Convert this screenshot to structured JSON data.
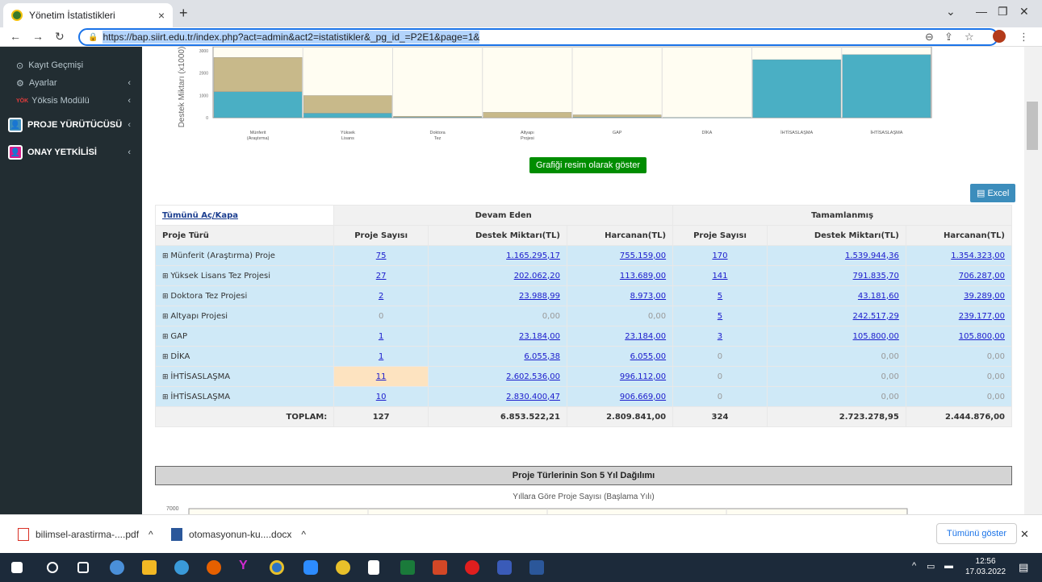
{
  "browser": {
    "tab_title": "Yönetim İstatistikleri",
    "url": "https://bap.siirt.edu.tr/index.php?act=admin&act2=istatistikler&_pg_id_=P2E1&page=1&"
  },
  "sidebar": {
    "items": [
      {
        "label": "Kayıt Geçmişi"
      },
      {
        "label": "Ayarlar"
      },
      {
        "label": "Yöksis Modülü"
      }
    ],
    "sections": [
      {
        "label": "PROJE YÜRÜTÜCÜSÜ"
      },
      {
        "label": "ONAY YETKİLİSİ"
      }
    ]
  },
  "chart_data": {
    "type": "bar",
    "ylabel": "Destek Miktarı (x1000)",
    "yticks": [
      "0",
      "1000",
      "2000",
      "3000"
    ],
    "ylim": [
      0,
      3000
    ],
    "categories": [
      "Münferit (Araştırma)",
      "Yüksek Lisans",
      "Doktora Tez",
      "Altyapı Projesi",
      "GAP",
      "DİKA",
      "İHTİSASLAŞMA",
      "İHTİSASLAŞMA"
    ],
    "series": [
      {
        "values": [
          1165,
          202,
          24,
          0,
          23,
          6,
          2603,
          2830
        ],
        "color": "#4aafc4"
      },
      {
        "values": [
          1540,
          792,
          43,
          243,
          106,
          0,
          0,
          0
        ],
        "color": "#c8b98a"
      }
    ]
  },
  "buttons": {
    "chart_image": "Grafiği resim olarak göster",
    "excel": "Excel"
  },
  "table": {
    "toggle_all": "Tümünü Aç/Kapa",
    "group_ongoing": "Devam Eden",
    "group_done": "Tamamlanmış",
    "columns": [
      "Proje Türü",
      "Proje Sayısı",
      "Destek Miktarı(TL)",
      "Harcanan(TL)",
      "Proje Sayısı",
      "Destek Miktarı(TL)",
      "Harcanan(TL)"
    ],
    "rows": [
      {
        "name": "Münferit (Araştırma) Proje",
        "c1": "75",
        "d1": "1.165.295,17",
        "h1": "755.159,00",
        "c2": "170",
        "d2": "1.539.944,36",
        "h2": "1.354.323,00"
      },
      {
        "name": "Yüksek Lisans Tez Projesi",
        "c1": "27",
        "d1": "202.062,20",
        "h1": "113.689,00",
        "c2": "141",
        "d2": "791.835,70",
        "h2": "706.287,00"
      },
      {
        "name": "Doktora Tez Projesi",
        "c1": "2",
        "d1": "23.988,99",
        "h1": "8.973,00",
        "c2": "5",
        "d2": "43.181,60",
        "h2": "39.289,00"
      },
      {
        "name": "Altyapı Projesi",
        "c1": "0",
        "d1": "0,00",
        "h1": "0,00",
        "c2": "5",
        "d2": "242.517,29",
        "h2": "239.177,00"
      },
      {
        "name": "GAP",
        "c1": "1",
        "d1": "23.184,00",
        "h1": "23.184,00",
        "c2": "3",
        "d2": "105.800,00",
        "h2": "105.800,00"
      },
      {
        "name": "DİKA",
        "c1": "1",
        "d1": "6.055,38",
        "h1": "6.055,00",
        "c2": "0",
        "d2": "0,00",
        "h2": "0,00"
      },
      {
        "name": "İHTİSASLAŞMA",
        "c1": "11",
        "d1": "2.602.536,00",
        "h1": "996.112,00",
        "c2": "0",
        "d2": "0,00",
        "h2": "0,00"
      },
      {
        "name": "İHTİSASLAŞMA",
        "c1": "10",
        "d1": "2.830.400,47",
        "h1": "906.669,00",
        "c2": "0",
        "d2": "0,00",
        "h2": "0,00"
      }
    ],
    "total_label": "TOPLAM:",
    "totals": {
      "c1": "127",
      "d1": "6.853.522,21",
      "h1": "2.809.841,00",
      "c2": "324",
      "d2": "2.723.278,95",
      "h2": "2.444.876,00"
    }
  },
  "section2": {
    "title": "Proje Türlerinin Son 5 Yıl Dağılımı",
    "chart_title": "Yıllara Göre Proje Sayısı (Başlama Yılı)",
    "ytick": "7000"
  },
  "downloads": {
    "items": [
      "bilimsel-arastirma-....pdf",
      "otomasyonun-ku....docx"
    ],
    "show_all": "Tümünü göster"
  },
  "taskbar": {
    "time": "12:56",
    "date": "17.03.2022"
  }
}
